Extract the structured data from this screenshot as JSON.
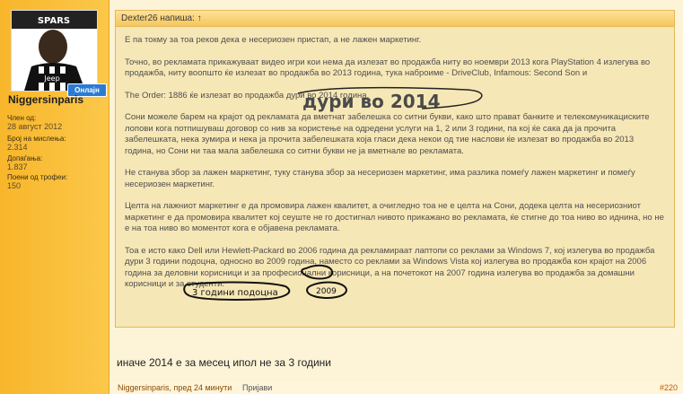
{
  "user": {
    "avatar_text": "Jeep",
    "online_badge": "Онлајн",
    "username": "Niggersinparis",
    "stats": [
      {
        "label": "Член од:",
        "value": "28 август 2012"
      },
      {
        "label": "Број на мислења:",
        "value": "2.314"
      },
      {
        "label": "Допаѓања:",
        "value": "1.837"
      },
      {
        "label": "Поени од трофеи:",
        "value": "150"
      }
    ]
  },
  "quote": {
    "header": "Dexter26 напиша: ↑",
    "paragraphs": [
      "Е па токму за тоа реков дека е несериозен пристап, а не лажен маркетинг.",
      "Точно, во рекламата прикажуваат видео игри кои нема да излезат во продажба ниту во ноември 2013 кога PlayStation 4 излегува во продажба, ниту воопшто ќе излезат во продажба во 2013 година, тука наброиме - DriveClub, Infamous: Second Son и",
      "The Order: 1886 ќе излезат во продажба дури во 2014 година.",
      "Сони можеле барем на крајот од рекламата да вметнат забелешка со ситни букви, како што прават банките и телекомуникациските лопови кога потпишуваш договор со нив за користење на одредени услуги на 1, 2 или 3 години, па кој ќе сака да ја прочита забелешката, нека зумира и нека ја прочита забелешката која гласи дека некои од тие наслови ќе излезат во продажба во 2013 година, но Сони ни таа мала забелешка со ситни букви не ја вметнале во рекламата.",
      "Не станува збор за лажен маркетинг, туку станува збор за несериозен маркетинг, има разлика помеѓу лажен маркетинг и помеѓу несериозен маркетинг.",
      "Целта на лажниот маркетинг е да промовира лажен квалитет, а очигледно тоа не е целта на Сони, додека целта на несериозниот маркетинг е да промовира квалитет кој сеуште не го достигнал нивото прикажано во рекламата, ќе стигне до тоа ниво во иднина, но не е на тоа ниво во моментот кога е објавена рекламата.",
      "Тоа е исто како Dell или Hewlett-Packard во 2006 година да рекламираат лаптопи со реклами за Windows 7, кој излегува во продажба дури 3 години подоцна, односно во 2009 година, наместо со реклами за Windows Vista кој излегува во продажба кон крајот на 2006 година за деловни корисници и за професионални корисници, а на почетокот на 2007 година излегува во продажба за домашни корисници и за студенти."
    ],
    "annotation_big": "дури во 2014",
    "annotation_small": "3 години подоцна",
    "annotation_year": "2009"
  },
  "reply": "иначе 2014 е за месец ипол не за 3 години",
  "footer": {
    "author": "Niggersinparis, пред 24 минути",
    "report": "Пријави",
    "number": "#220"
  }
}
